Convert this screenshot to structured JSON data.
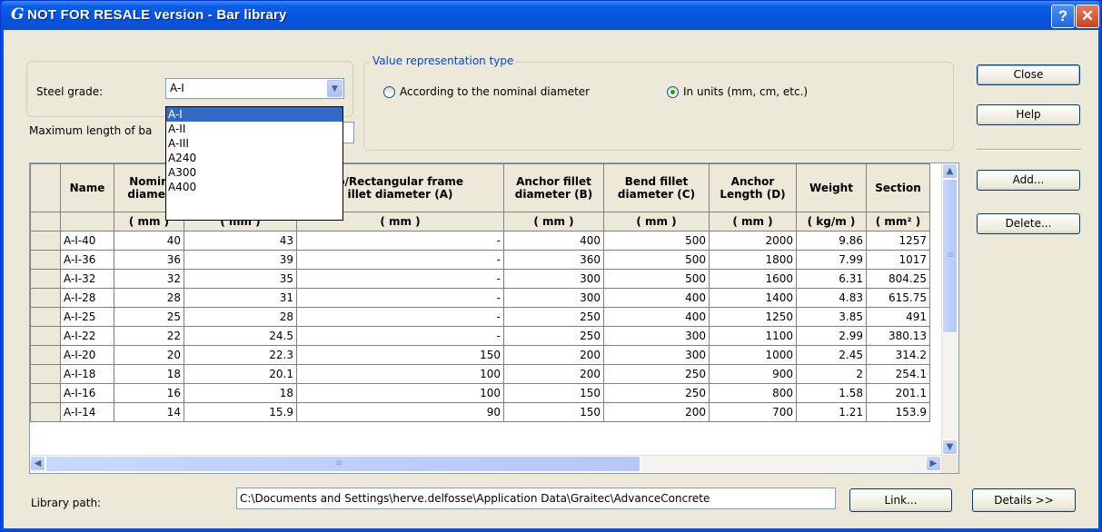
{
  "window": {
    "title": "NOT FOR RESALE version - Bar library",
    "app_icon": "G",
    "help_label": "?",
    "close_label": "✕"
  },
  "steel": {
    "label": "Steel grade:",
    "value": "A-I",
    "options": [
      "A-I",
      "A-II",
      "A-III",
      "A240",
      "A300",
      "A400"
    ]
  },
  "maxlen": {
    "label": "Maximum length of ba"
  },
  "representation": {
    "legend": "Value representation type",
    "options": [
      {
        "label": "According to the nominal diameter",
        "selected": false
      },
      {
        "label": "In units (mm, cm, etc.)",
        "selected": true
      }
    ]
  },
  "buttons": {
    "close": "Close",
    "help": "Help",
    "add": "Add...",
    "delete": "Delete...",
    "link": "Link...",
    "details": "Details >>"
  },
  "table": {
    "headers": [
      "Name",
      "Nomin diamet",
      "",
      "p/Rectangular frame illet diameter (A)",
      "Anchor fillet diameter (B)",
      "Bend fillet diameter (C)",
      "Anchor Length (D)",
      "Weight",
      "Section"
    ],
    "header_lines": [
      [
        "Name"
      ],
      [
        "Nomin",
        "diamet"
      ],
      [
        ""
      ],
      [
        "p/Rectangular frame",
        "illet diameter (A)"
      ],
      [
        "Anchor fillet",
        "diameter (B)"
      ],
      [
        "Bend fillet",
        "diameter (C)"
      ],
      [
        "Anchor",
        "Length (D)"
      ],
      [
        "Weight"
      ],
      [
        "Section"
      ]
    ],
    "units": [
      "",
      "( mm )",
      "( mm )",
      "( mm )",
      "( mm )",
      "( mm )",
      "( mm )",
      "( kg/m )",
      "( mm² )"
    ],
    "rows": [
      [
        "A-I-40",
        "40",
        "43",
        "-",
        "400",
        "500",
        "2000",
        "9.86",
        "1257"
      ],
      [
        "A-I-36",
        "36",
        "39",
        "-",
        "360",
        "500",
        "1800",
        "7.99",
        "1017"
      ],
      [
        "A-I-32",
        "32",
        "35",
        "-",
        "300",
        "500",
        "1600",
        "6.31",
        "804.25"
      ],
      [
        "A-I-28",
        "28",
        "31",
        "-",
        "300",
        "400",
        "1400",
        "4.83",
        "615.75"
      ],
      [
        "A-I-25",
        "25",
        "28",
        "-",
        "250",
        "400",
        "1250",
        "3.85",
        "491"
      ],
      [
        "A-I-22",
        "22",
        "24.5",
        "-",
        "250",
        "300",
        "1100",
        "2.99",
        "380.13"
      ],
      [
        "A-I-20",
        "20",
        "22.3",
        "150",
        "200",
        "300",
        "1000",
        "2.45",
        "314.2"
      ],
      [
        "A-I-18",
        "18",
        "20.1",
        "100",
        "200",
        "250",
        "900",
        "2",
        "254.1"
      ],
      [
        "A-I-16",
        "16",
        "18",
        "100",
        "150",
        "250",
        "800",
        "1.58",
        "201.1"
      ],
      [
        "A-I-14",
        "14",
        "15.9",
        "90",
        "150",
        "200",
        "700",
        "1.21",
        "153.9"
      ]
    ]
  },
  "library": {
    "label": "Library path:",
    "path": "C:\\Documents and Settings\\herve.delfosse\\Application Data\\Graitec\\AdvanceConcrete"
  },
  "icons": {
    "scroll_up": "▲",
    "scroll_down": "▼",
    "scroll_left": "◀",
    "scroll_right": "▶",
    "combo_arrow": "▼",
    "scroll_grip": "≡"
  }
}
